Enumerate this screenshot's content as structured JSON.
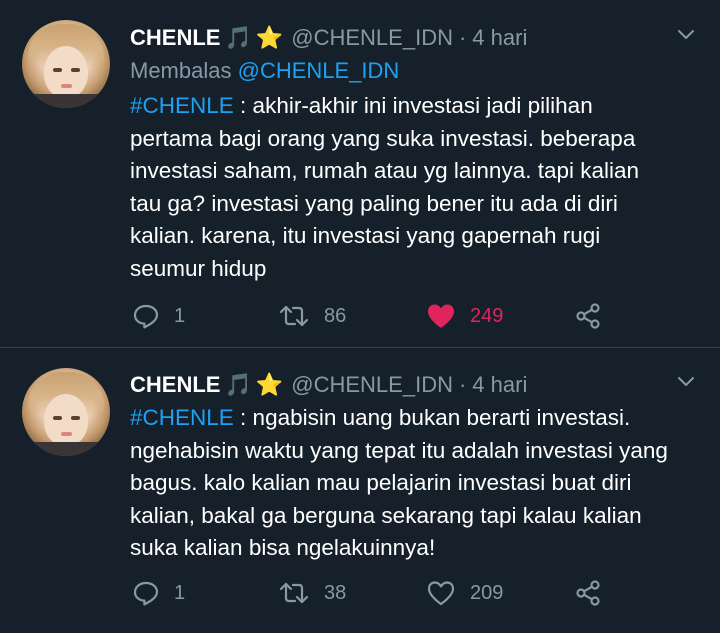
{
  "tweets": [
    {
      "author": {
        "name": "CHENLE",
        "emoji": [
          "🎵",
          "⭐"
        ],
        "handle": "@CHENLE_IDN"
      },
      "separator": "·",
      "time": "4 hari",
      "reply_prefix": "Membalas",
      "reply_to": "@CHENLE_IDN",
      "hashtag": "#CHENLE",
      "lines": [
        " : akhir-akhir ini investasi jadi pilihan",
        "pertama bagi orang yang suka investasi. beberapa",
        "investasi saham, rumah atau yg lainnya. tapi kalian",
        "tau ga? investasi yang paling bener itu ada di diri",
        "kalian. karena, itu investasi yang gapernah rugi",
        "seumur hidup"
      ],
      "actions": {
        "replies": "1",
        "retweets": "86",
        "likes": "249",
        "liked": true
      },
      "icons": {
        "reply": "reply-icon",
        "retweet": "retweet-icon",
        "like": "heart-filled-icon",
        "share": "share-icon",
        "menu": "chevron-down-icon"
      }
    },
    {
      "author": {
        "name": "CHENLE",
        "emoji": [
          "🎵",
          "⭐"
        ],
        "handle": "@CHENLE_IDN"
      },
      "separator": "·",
      "time": "4 hari",
      "hashtag": "#CHENLE",
      "lines": [
        " : ngabisin uang bukan berarti investasi.",
        "ngehabisin waktu yang tepat itu adalah investasi yang",
        "bagus. kalo kalian mau pelajarin investasi buat diri",
        "kalian, bakal ga berguna sekarang tapi kalau kalian",
        "suka kalian bisa ngelakuinnya!"
      ],
      "actions": {
        "replies": "1",
        "retweets": "38",
        "likes": "209",
        "liked": false
      },
      "icons": {
        "reply": "reply-icon",
        "retweet": "retweet-icon",
        "like": "heart-outline-icon",
        "share": "share-icon",
        "menu": "chevron-down-icon"
      }
    }
  ],
  "colors": {
    "background": "#15202b",
    "text": "#ffffff",
    "secondary": "#8899a6",
    "link": "#1da1f2",
    "like": "#e0245e",
    "divider": "#38444d"
  }
}
